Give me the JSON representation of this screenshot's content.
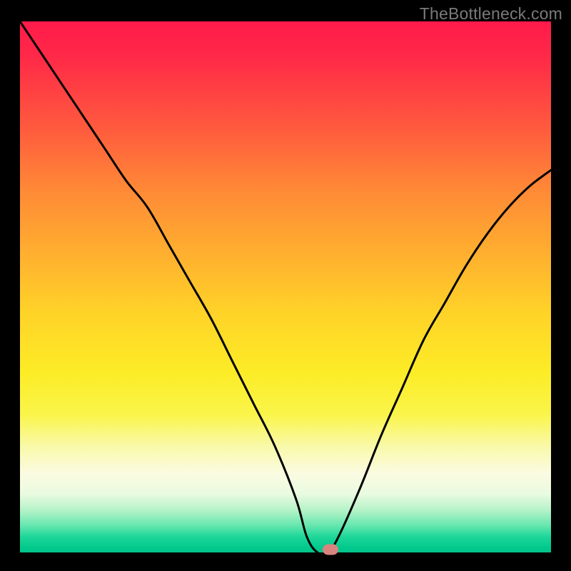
{
  "watermark": "TheBottleneck.com",
  "chart_data": {
    "type": "line",
    "title": "",
    "xlabel": "",
    "ylabel": "",
    "xlim": [
      0,
      100
    ],
    "ylim": [
      0,
      100
    ],
    "grid": false,
    "legend": false,
    "x": [
      0,
      4,
      8,
      12,
      16,
      20,
      24,
      28,
      32,
      36,
      40,
      44,
      48,
      52,
      54,
      56,
      58,
      60,
      64,
      68,
      72,
      76,
      80,
      84,
      88,
      92,
      96,
      100
    ],
    "y": [
      100,
      94,
      88,
      82,
      76,
      70,
      65,
      58,
      51,
      44,
      36,
      28,
      20,
      10,
      3,
      0,
      0,
      3,
      12,
      22,
      31,
      40,
      47,
      54,
      60,
      65,
      69,
      72
    ],
    "marker": {
      "x": 58.5,
      "y": 0
    },
    "gradient_stops": [
      {
        "pos": 0.0,
        "color": "#ff1a4b"
      },
      {
        "pos": 0.3,
        "color": "#ff8a36"
      },
      {
        "pos": 0.6,
        "color": "#fcec26"
      },
      {
        "pos": 0.85,
        "color": "#fbfbe1"
      },
      {
        "pos": 1.0,
        "color": "#02c48a"
      }
    ]
  }
}
